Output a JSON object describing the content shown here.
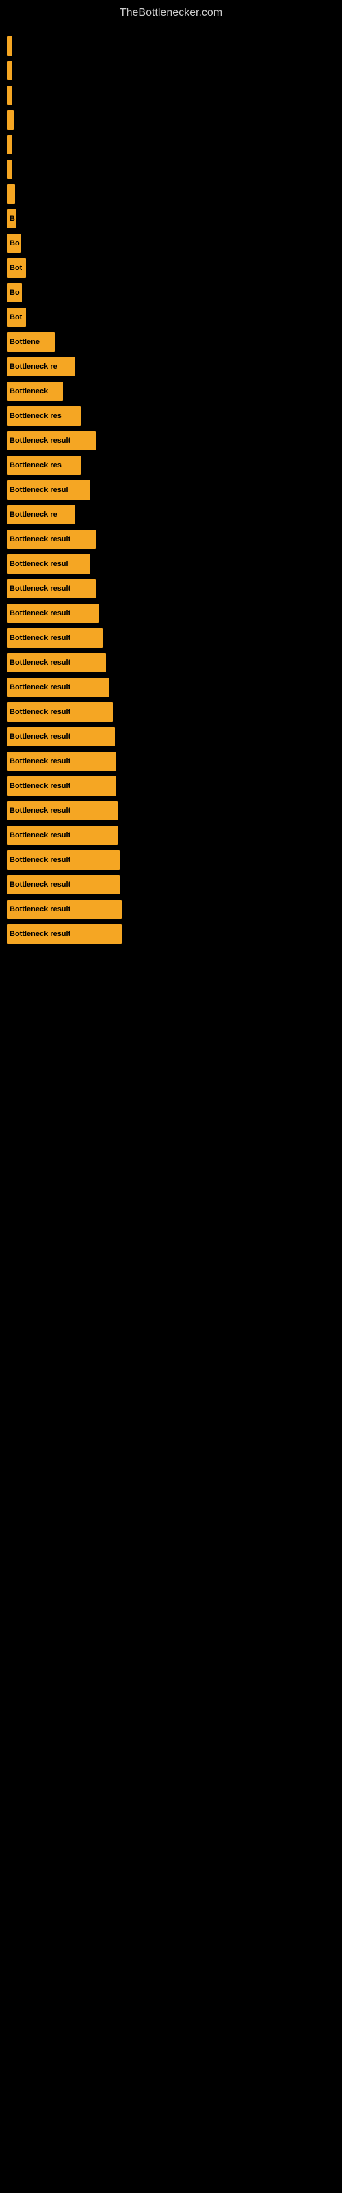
{
  "site": {
    "title": "TheBottlenecker.com"
  },
  "bars": [
    {
      "id": 1,
      "label": "",
      "width": 8
    },
    {
      "id": 2,
      "label": "",
      "width": 8
    },
    {
      "id": 3,
      "label": "",
      "width": 8
    },
    {
      "id": 4,
      "label": "",
      "width": 10
    },
    {
      "id": 5,
      "label": "",
      "width": 8
    },
    {
      "id": 6,
      "label": "",
      "width": 8
    },
    {
      "id": 7,
      "label": "",
      "width": 12
    },
    {
      "id": 8,
      "label": "B",
      "width": 14
    },
    {
      "id": 9,
      "label": "Bo",
      "width": 20
    },
    {
      "id": 10,
      "label": "Bot",
      "width": 28
    },
    {
      "id": 11,
      "label": "Bo",
      "width": 22
    },
    {
      "id": 12,
      "label": "Bot",
      "width": 28
    },
    {
      "id": 13,
      "label": "Bottlene",
      "width": 70
    },
    {
      "id": 14,
      "label": "Bottleneck re",
      "width": 100
    },
    {
      "id": 15,
      "label": "Bottleneck",
      "width": 82
    },
    {
      "id": 16,
      "label": "Bottleneck res",
      "width": 108
    },
    {
      "id": 17,
      "label": "Bottleneck result",
      "width": 130
    },
    {
      "id": 18,
      "label": "Bottleneck res",
      "width": 108
    },
    {
      "id": 19,
      "label": "Bottleneck resul",
      "width": 122
    },
    {
      "id": 20,
      "label": "Bottleneck re",
      "width": 100
    },
    {
      "id": 21,
      "label": "Bottleneck result",
      "width": 130
    },
    {
      "id": 22,
      "label": "Bottleneck resul",
      "width": 122
    },
    {
      "id": 23,
      "label": "Bottleneck result",
      "width": 130
    },
    {
      "id": 24,
      "label": "Bottleneck result",
      "width": 135
    },
    {
      "id": 25,
      "label": "Bottleneck result",
      "width": 140
    },
    {
      "id": 26,
      "label": "Bottleneck result",
      "width": 145
    },
    {
      "id": 27,
      "label": "Bottleneck result",
      "width": 150
    },
    {
      "id": 28,
      "label": "Bottleneck result",
      "width": 155
    },
    {
      "id": 29,
      "label": "Bottleneck result",
      "width": 158
    },
    {
      "id": 30,
      "label": "Bottleneck result",
      "width": 160
    },
    {
      "id": 31,
      "label": "Bottleneck result",
      "width": 160
    },
    {
      "id": 32,
      "label": "Bottleneck result",
      "width": 162
    },
    {
      "id": 33,
      "label": "Bottleneck result",
      "width": 162
    },
    {
      "id": 34,
      "label": "Bottleneck result",
      "width": 165
    },
    {
      "id": 35,
      "label": "Bottleneck result",
      "width": 165
    },
    {
      "id": 36,
      "label": "Bottleneck result",
      "width": 168
    },
    {
      "id": 37,
      "label": "Bottleneck result",
      "width": 168
    }
  ]
}
